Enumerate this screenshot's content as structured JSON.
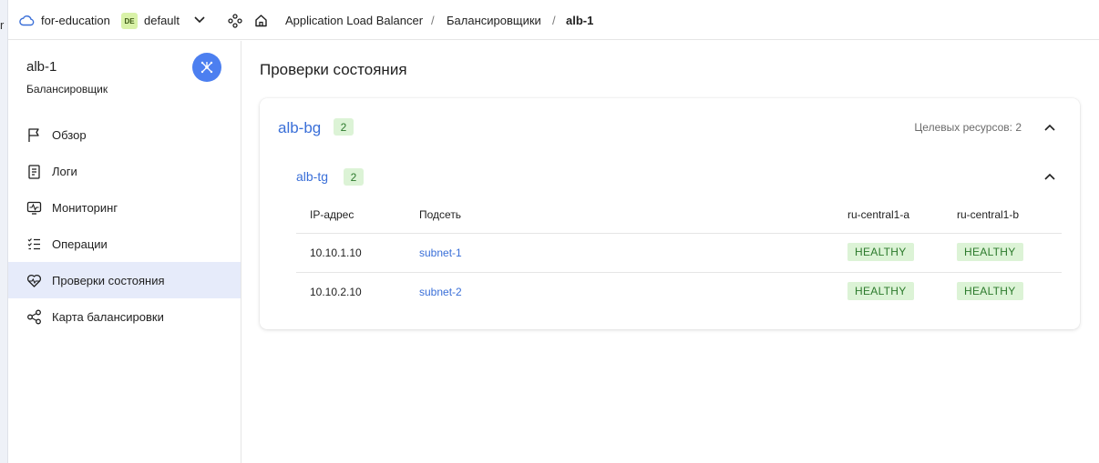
{
  "edge": {
    "char": "r"
  },
  "header": {
    "org": "for-education",
    "folder_badge": "DE",
    "folder": "default",
    "breadcrumbs": [
      "Application Load Balancer",
      "Балансировщики",
      "alb-1"
    ]
  },
  "sidebar": {
    "title": "alb-1",
    "subtitle": "Балансировщик",
    "items": [
      {
        "label": "Обзор",
        "icon": "flag-icon"
      },
      {
        "label": "Логи",
        "icon": "log-icon"
      },
      {
        "label": "Мониторинг",
        "icon": "monitoring-icon"
      },
      {
        "label": "Операции",
        "icon": "operations-icon"
      },
      {
        "label": "Проверки состояния",
        "icon": "heartbeat-icon",
        "active": true
      },
      {
        "label": "Карта балансировки",
        "icon": "map-icon"
      }
    ]
  },
  "main": {
    "title": "Проверки состояния",
    "backend_group": {
      "name": "alb-bg",
      "count": "2",
      "targets_label": "Целевых ресурсов: 2"
    },
    "target_group": {
      "name": "alb-tg",
      "count": "2"
    },
    "table": {
      "headers": [
        "IP-адрес",
        "Подсеть",
        "ru-central1-a",
        "ru-central1-b"
      ],
      "rows": [
        {
          "ip": "10.10.1.10",
          "subnet": "subnet-1",
          "zone_a": "HEALTHY",
          "zone_b": "HEALTHY"
        },
        {
          "ip": "10.10.2.10",
          "subnet": "subnet-2",
          "zone_a": "HEALTHY",
          "zone_b": "HEALTHY"
        }
      ]
    }
  },
  "colors": {
    "accent": "#3a6fd8",
    "healthy_bg": "#dcf3d6",
    "healthy_text": "#2c7a2c",
    "active_nav": "#e6ebfa"
  }
}
